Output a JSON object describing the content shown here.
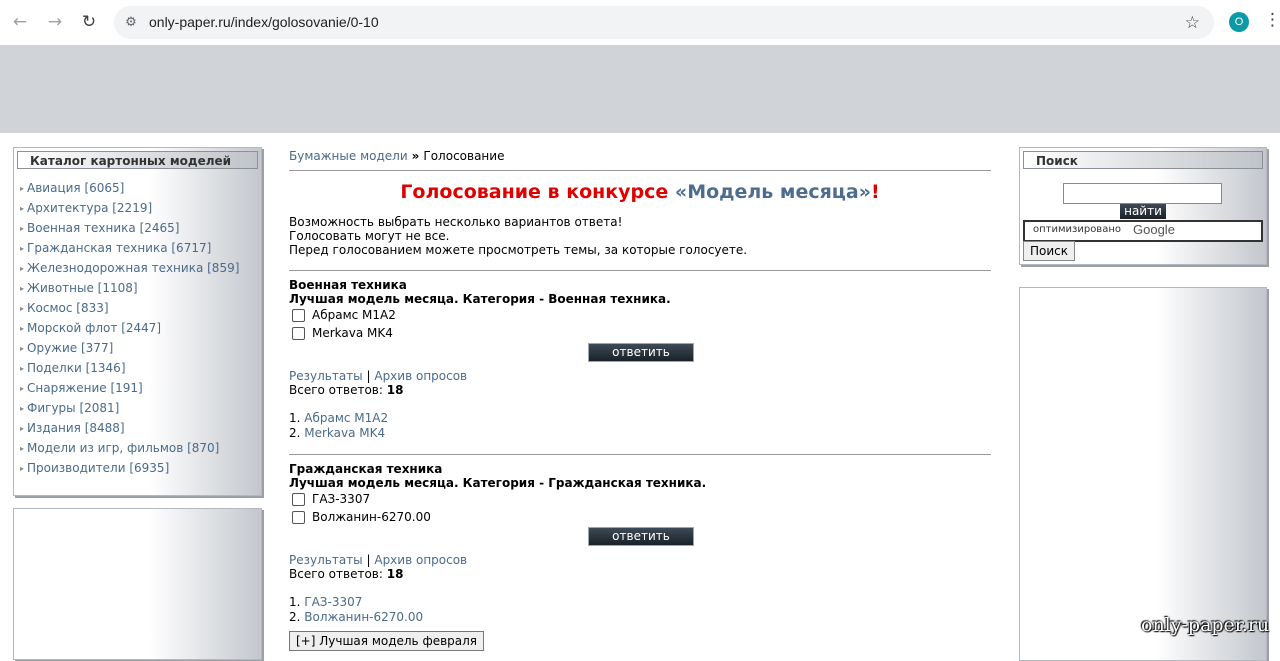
{
  "browser": {
    "back_glyph": "←",
    "forward_glyph": "→",
    "reload_glyph": "↻",
    "site_info_glyph": "⚙",
    "url": "only-paper.ru/index/golosovanie/0-10",
    "bookmark_glyph": "☆",
    "profile_initial": "O",
    "menu_glyph": "⋮"
  },
  "catalog": {
    "title": "Каталог картонных моделей",
    "bullet": "▸",
    "items": [
      "Авиация [6065]",
      "Архитектура [2219]",
      "Военная техника [2465]",
      "Гражданская техника [6717]",
      "Железнодорожная техника [859]",
      "Животные [1108]",
      "Космос [833]",
      "Морской флот [2447]",
      "Оружие [377]",
      "Поделки [1346]",
      "Снаряжение [191]",
      "Фигуры [2081]",
      "Издания [8488]",
      "Модели из игр, фильмов [870]",
      "Производители [6935]"
    ]
  },
  "breadcrumb": {
    "home": "Бумажные модели",
    "separator": "»",
    "current": "Голосование"
  },
  "page": {
    "title_part1": "Голосование в конкурсе ",
    "title_part2": "«Модель месяца»",
    "title_part3": "!",
    "intro": [
      "Возможность выбрать несколько вариантов ответа!",
      "Голосовать могут не все.",
      "Перед голосованием можете просмотреть темы, за которые голосуете."
    ]
  },
  "polls": [
    {
      "category": "Военная техника",
      "question": "Лучшая модель месяца. Категория - Военная техника.",
      "options": [
        "Абрамс М1А2",
        "Merkava MK4"
      ],
      "vote_label": "ответить",
      "results_label": "Результаты",
      "link_separator": "|",
      "archive_label": "Архив опросов",
      "total_label": "Всего ответов:",
      "total_value": "18",
      "results": [
        "Абрамс М1А2",
        "Merkava MK4"
      ]
    },
    {
      "category": "Гражданская техника",
      "question": "Лучшая модель месяца. Категория - Гражданская техника.",
      "options": [
        "ГАЗ-3307",
        "Волжанин-6270.00"
      ],
      "vote_label": "ответить",
      "results_label": "Результаты",
      "link_separator": "|",
      "archive_label": "Архив опросов",
      "total_label": "Всего ответов:",
      "total_value": "18",
      "results": [
        "ГАЗ-3307",
        "Волжанин-6270.00"
      ]
    }
  ],
  "toggle_label": "[+] Лучшая модель февраля",
  "search": {
    "title": "Поиск",
    "go_label": "найти",
    "google_prefix": "оптимизировано",
    "google_brand": "Google",
    "button_label": "Поиск"
  },
  "watermark": "only-paper.ru"
}
